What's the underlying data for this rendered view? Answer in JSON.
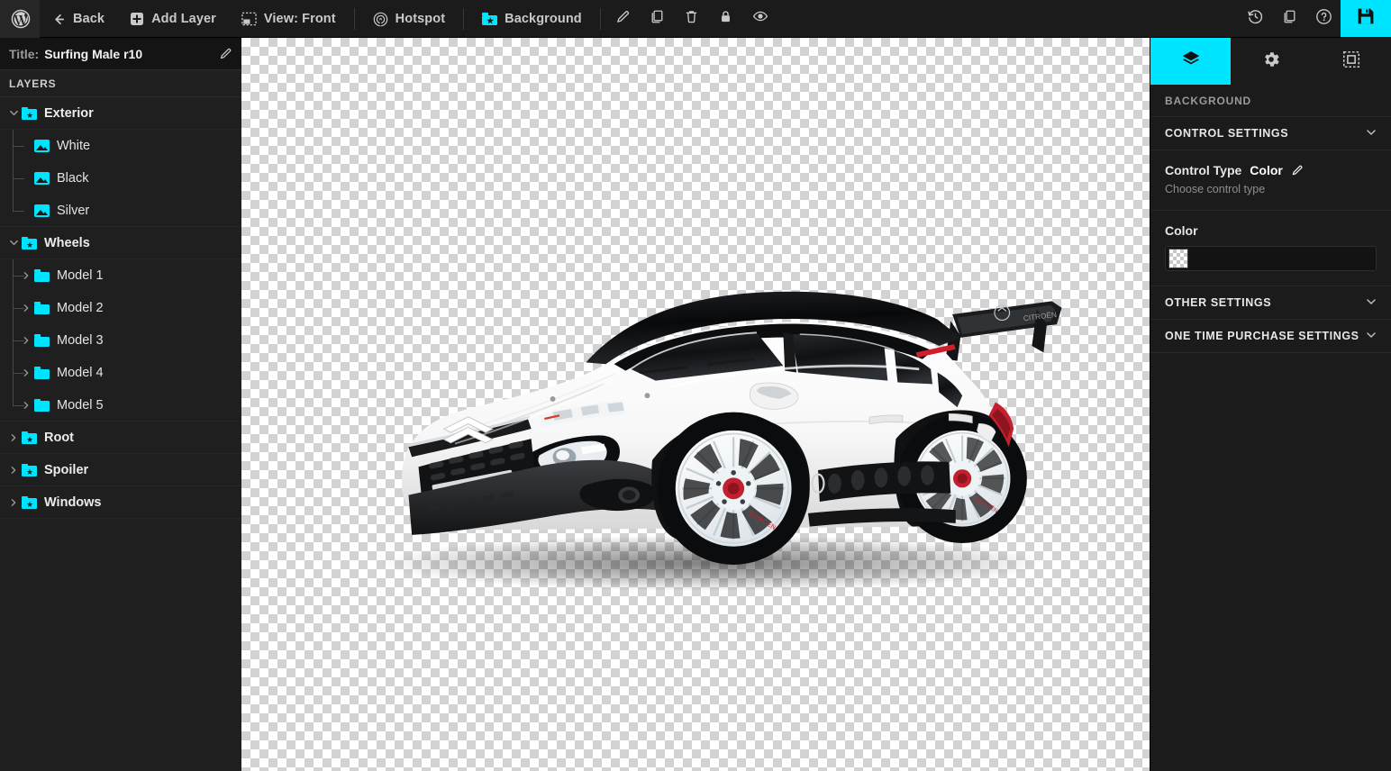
{
  "toolbar": {
    "logo": "wordpress-logo",
    "back": "Back",
    "add_layer": "Add Layer",
    "view": "View: Front",
    "hotspot": "Hotspot",
    "background": "Background",
    "icons": {
      "edit": "pencil-icon",
      "duplicate": "copy-icon",
      "delete": "trash-icon",
      "lock": "lock-icon",
      "visibility": "eye-icon",
      "history": "history-icon",
      "clone": "duplicate-icon",
      "help": "help-icon",
      "save": "save-icon"
    },
    "accent_color": "#00e5ff"
  },
  "sidebar": {
    "title_key": "Title:",
    "title_value": "Surfing Male r10",
    "layers_header": "LAYERS",
    "layers": [
      {
        "label": "Exterior",
        "type": "folder-star",
        "depth": 0,
        "expanded": true
      },
      {
        "label": "White",
        "type": "image",
        "depth": 1
      },
      {
        "label": "Black",
        "type": "image",
        "depth": 1
      },
      {
        "label": "Silver",
        "type": "image",
        "depth": 1
      },
      {
        "label": "Wheels",
        "type": "folder-star",
        "depth": 0,
        "expanded": true
      },
      {
        "label": "Model 1",
        "type": "folder-plain",
        "depth": 1,
        "expanded": false
      },
      {
        "label": "Model 2",
        "type": "folder-plain",
        "depth": 1,
        "expanded": false
      },
      {
        "label": "Model 3",
        "type": "folder-plain",
        "depth": 1,
        "expanded": false
      },
      {
        "label": "Model 4",
        "type": "folder-plain",
        "depth": 1,
        "expanded": false
      },
      {
        "label": "Model 5",
        "type": "folder-plain",
        "depth": 1,
        "expanded": false
      },
      {
        "label": "Root",
        "type": "folder-star",
        "depth": 0,
        "expanded": false
      },
      {
        "label": "Spoiler",
        "type": "folder-star",
        "depth": 0,
        "expanded": false
      },
      {
        "label": "Windows",
        "type": "folder-star",
        "depth": 0,
        "expanded": false
      }
    ]
  },
  "canvas": {
    "background": "transparent-checkerboard",
    "artwork": "white-citroen-c3-with-black-roof-and-rally-spoiler"
  },
  "right_panel": {
    "tabs": [
      {
        "name": "layers",
        "icon": "layers-icon",
        "active": true
      },
      {
        "name": "settings",
        "icon": "gear-icon",
        "active": false
      },
      {
        "name": "selection",
        "icon": "selection-icon",
        "active": false
      }
    ],
    "context_label": "BACKGROUND",
    "sections": [
      {
        "title": "CONTROL SETTINGS",
        "expanded": true
      },
      {
        "title": "OTHER SETTINGS",
        "expanded": false
      },
      {
        "title": "ONE TIME PURCHASE SETTINGS",
        "expanded": false
      }
    ],
    "control_type_label": "Control Type",
    "control_type_value": "Color",
    "control_type_hint": "Choose control type",
    "color_label": "Color",
    "color_value": "transparent"
  }
}
